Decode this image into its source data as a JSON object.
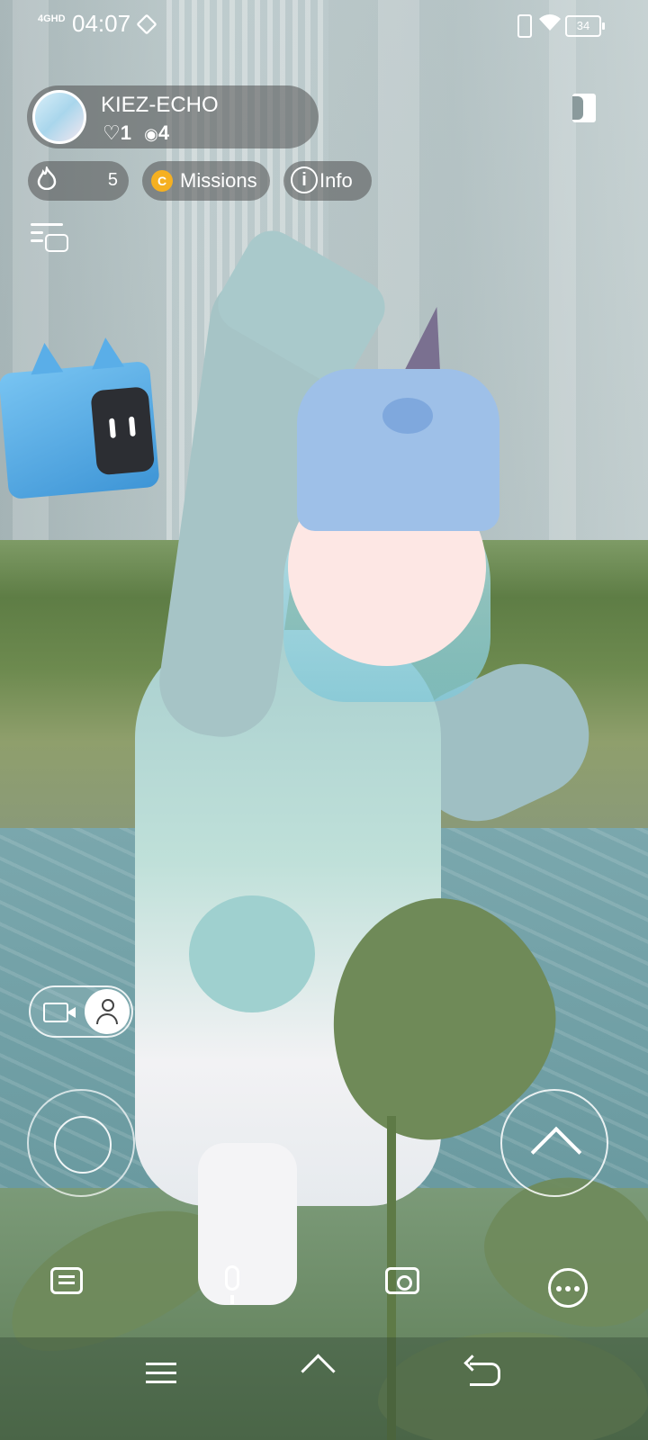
{
  "status_bar": {
    "network": "4GHD",
    "time": "04:07",
    "battery": "34",
    "icons": [
      "location-icon",
      "vibrate-icon",
      "wifi-icon",
      "battery-icon"
    ]
  },
  "profile": {
    "username": "KIEZ-ECHO",
    "likes": "1",
    "views": "4"
  },
  "chips": {
    "fire_count": "5",
    "coin_symbol": "C",
    "missions_label": "Missions",
    "info_label": "Info"
  },
  "bottom_bar": {
    "icons": [
      "chat-icon",
      "microphone-icon",
      "camera-icon",
      "more-icon"
    ]
  },
  "system_nav": {
    "icons": [
      "menu-icon",
      "home-icon",
      "back-icon"
    ]
  },
  "colors": {
    "pill_bg": "#50505080",
    "coin": "#f5b021",
    "cube": "#5aaee8"
  }
}
